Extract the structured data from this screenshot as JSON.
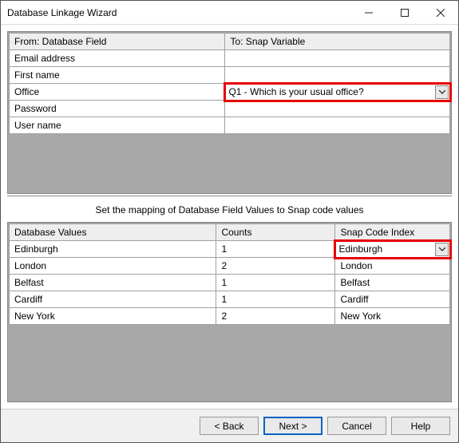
{
  "window": {
    "title": "Database Linkage Wizard"
  },
  "upper": {
    "headers": {
      "from": "From: Database Field",
      "to": "To: Snap Variable"
    },
    "rows": [
      {
        "from": "Email address",
        "to": ""
      },
      {
        "from": "First name",
        "to": ""
      },
      {
        "from": "Office",
        "to_dropdown": "Q1 - Which is your usual office?"
      },
      {
        "from": "Password",
        "to": ""
      },
      {
        "from": "User name",
        "to": ""
      }
    ]
  },
  "caption": "Set the mapping of Database Field Values to Snap code values",
  "lower": {
    "headers": {
      "dbv": "Database Values",
      "cnt": "Counts",
      "sci": "Snap Code Index"
    },
    "rows": [
      {
        "dbv": "Edinburgh",
        "cnt": "1",
        "sci_dropdown": "Edinburgh"
      },
      {
        "dbv": "London",
        "cnt": "2",
        "sci": "London"
      },
      {
        "dbv": "Belfast",
        "cnt": "1",
        "sci": "Belfast"
      },
      {
        "dbv": "Cardiff",
        "cnt": "1",
        "sci": "Cardiff"
      },
      {
        "dbv": "New York",
        "cnt": "2",
        "sci": "New York"
      }
    ]
  },
  "footer": {
    "back": "< Back",
    "next": "Next >",
    "cancel": "Cancel",
    "help": "Help"
  }
}
